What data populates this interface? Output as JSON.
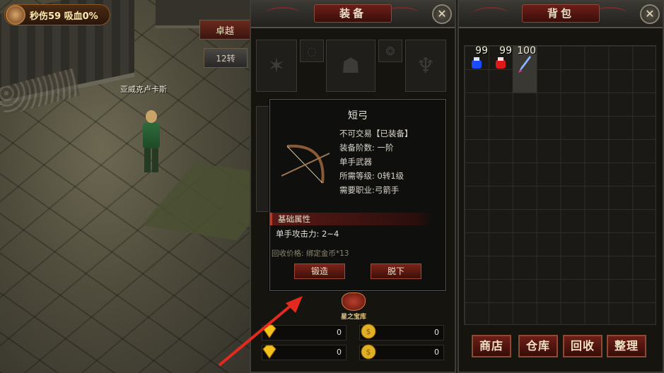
{
  "hud": {
    "stats": "秒伤59  吸血0%",
    "excellence_button": "卓越",
    "rebirth_button": "12转",
    "npc_name": "亚威克卢卡斯"
  },
  "equipment_panel": {
    "title": "装备",
    "close_icon": "close-x-icon",
    "tooltip": {
      "name": "短弓",
      "lines": [
        "不可交易【已装备】",
        "装备阶数: 一阶",
        "单手武器",
        "所需等级: 0转1级",
        "需要职业:弓箭手"
      ],
      "section_title": "基础属性",
      "attack": "单手攻击力: 2~4",
      "recycle_price": "回收价格: 绑定金币*13",
      "forge_button": "锻造",
      "unequip_button": "脱下"
    },
    "treasure_label": "星之宝库",
    "currencies": [
      {
        "icon": "diamond-icon",
        "value": "0"
      },
      {
        "icon": "gold-coin-icon",
        "value": "0"
      },
      {
        "icon": "bound-diamond-icon",
        "value": "0"
      },
      {
        "icon": "bound-gold-coin-icon",
        "value": "0"
      }
    ]
  },
  "bag_panel": {
    "title": "背包",
    "items": [
      {
        "name": "blue-potion",
        "count": "99",
        "color": "#1a4cff"
      },
      {
        "name": "red-potion",
        "count": "99",
        "color": "#e01818"
      },
      {
        "name": "crystal-dagger",
        "count": "100",
        "color": "#7aa8ff"
      }
    ],
    "buttons": [
      "商店",
      "仓库",
      "回收",
      "整理"
    ]
  }
}
